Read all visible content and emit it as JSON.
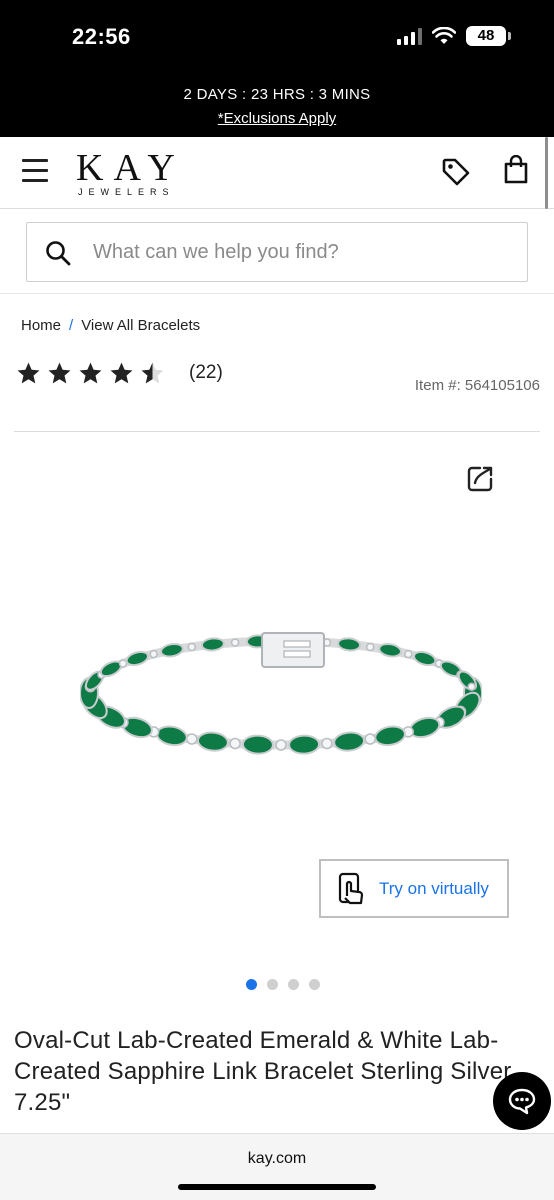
{
  "status_bar": {
    "time": "22:56",
    "battery": "48"
  },
  "promo": {
    "countdown": "2 DAYS : 23 HRS : 3 MINS",
    "link": "*Exclusions Apply"
  },
  "header": {
    "logo_main": "KAY",
    "logo_sub": "JEWELERS"
  },
  "search": {
    "placeholder": "What can we help you find?"
  },
  "breadcrumb": {
    "home": "Home",
    "separator": "/",
    "current": "View All Bracelets"
  },
  "rating": {
    "value": 4.5,
    "max": 5,
    "count": "(22)"
  },
  "item": {
    "number": "Item #: 564105106"
  },
  "gallery": {
    "total": 4,
    "active_index": 0
  },
  "try_on": {
    "label": "Try on virtually"
  },
  "product": {
    "title": "Oval-Cut Lab-Created Emerald & White Lab-Created Sapphire Link Bracelet Sterling Silver 7.25\""
  },
  "browser": {
    "url": "kay.com"
  },
  "colors": {
    "accent": "#1a73e8",
    "emerald": "#0e7a45",
    "topbar": "#000000"
  },
  "icons": [
    "hamburger-icon",
    "tag-icon",
    "shopping-bag-icon",
    "search-icon",
    "star-icon",
    "share-icon",
    "try-on-hand-icon",
    "chat-icon"
  ]
}
